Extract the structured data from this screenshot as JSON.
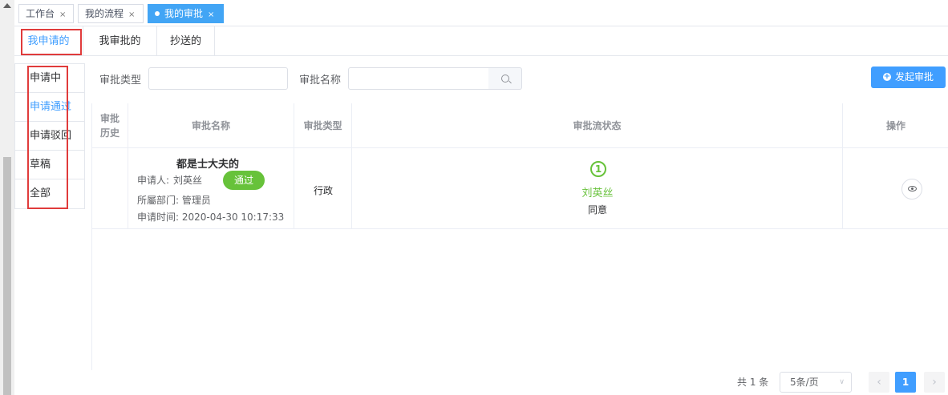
{
  "window_tabs": [
    {
      "label": "工作台",
      "close": "×"
    },
    {
      "label": "我的流程",
      "close": "×"
    },
    {
      "label": "我的审批",
      "close": "×",
      "active": true
    }
  ],
  "sub_tabs": [
    {
      "label": "我申请的",
      "active": true
    },
    {
      "label": "我审批的"
    },
    {
      "label": "抄送的"
    }
  ],
  "side_menu": [
    {
      "label": "申请中"
    },
    {
      "label": "申请通过",
      "active": true
    },
    {
      "label": "申请驳回"
    },
    {
      "label": "草稿"
    },
    {
      "label": "全部"
    }
  ],
  "filters": {
    "type_label": "审批类型",
    "type_value": "",
    "name_label": "审批名称",
    "name_value": "",
    "create_button": "发起审批"
  },
  "table": {
    "headers": [
      "审批历史",
      "审批名称",
      "审批类型",
      "审批流状态",
      "操作"
    ],
    "rows": [
      {
        "title": "都是士大夫的",
        "applicant_label": "申请人:",
        "applicant": "刘英丝",
        "status_badge": "通过",
        "department": "所屬部门: 管理员",
        "apply_time": "申请时间: 2020-04-30 10:17:33",
        "type": "行政",
        "flow_step": "1",
        "flow_user": "刘英丝",
        "flow_result": "同意"
      }
    ]
  },
  "pagination": {
    "total": "共 1 条",
    "page_size": "5条/页",
    "prev": "‹",
    "current": "1",
    "next": "›"
  },
  "colors": {
    "primary": "#409eff",
    "success": "#67c23a",
    "highlight_box": "#e03b3b"
  }
}
